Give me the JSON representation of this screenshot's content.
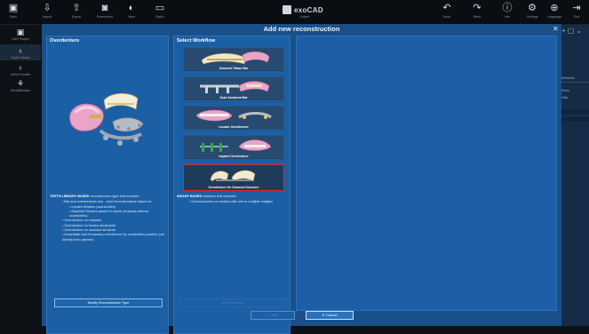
{
  "topbar": {
    "items": [
      {
        "label": "Save",
        "icon": "save-icon",
        "glyph": "▣"
      },
      {
        "label": "Import",
        "icon": "import-icon",
        "glyph": "⇩"
      },
      {
        "label": "Export",
        "icon": "export-icon",
        "glyph": "⇧"
      },
      {
        "label": "Screenshot",
        "icon": "camera-icon",
        "glyph": "◙"
      },
      {
        "label": "View",
        "icon": "contrast-icon",
        "glyph": "◐"
      },
      {
        "label": "Batch",
        "icon": "monitor-icon",
        "glyph": "▭"
      }
    ],
    "brand_name": "exoCAD",
    "brand_sub": "Expert",
    "right_items": [
      {
        "label": "Undo",
        "icon": "undo-icon",
        "glyph": "↶"
      },
      {
        "label": "Redo",
        "icon": "redo-icon",
        "glyph": "↷"
      },
      {
        "label": "Info",
        "icon": "info-icon",
        "glyph": "ⓘ"
      },
      {
        "label": "Settings",
        "icon": "gear-icon",
        "glyph": "⚙"
      },
      {
        "label": "Language",
        "icon": "globe-icon",
        "glyph": "⊕"
      },
      {
        "label": "Exit",
        "icon": "exit-icon",
        "glyph": "⇥"
      }
    ]
  },
  "leftbar": {
    "items": [
      {
        "label": "CAD Project",
        "icon": "cad-project-icon",
        "glyph": "▣"
      },
      {
        "label": "Tooth Library",
        "icon": "tooth-icon",
        "glyph": "♁"
      },
      {
        "label": "Active Models",
        "icon": "models-icon",
        "glyph": "♁"
      },
      {
        "label": "DentalBrowse",
        "icon": "tools-icon",
        "glyph": "⚘"
      }
    ]
  },
  "dialog": {
    "title": "Add new reconstruction",
    "close_glyph": "✕",
    "left_panel": {
      "title": "Overdenture",
      "desc_head": "TEETH LIBRARY BASED",
      "desc_tail": "reconstruction type that includes:",
      "bullets": [
        "Bar and overdentures one - shot reconstructions based on:",
        "Implant libraries (scanbodies)",
        "Scanned Tibases placed in mouth (implants without scanbodies)",
        "Overdenture on implants",
        "Overdenture on locator abutments",
        "Overdenture on scanned structure",
        "Immediate load temporary overdenture by scanbodies position (not directly from planner)"
      ],
      "button": "Modify Reconstruction Type"
    },
    "middle_panel": {
      "title": "Select Workflow",
      "tiles": [
        {
          "label": "Scanned Tibase Bar"
        },
        {
          "label": "Scan Abutment Bar"
        },
        {
          "label": "Locator Overdenture"
        },
        {
          "label": "Implant Overdenture"
        },
        {
          "label": "Overdenture On Scanned Structure"
        }
      ],
      "selected_index": 4,
      "desc_head": "WAXUP BASED",
      "desc_tail": "workflow that includes:",
      "bullet": "Overstructures on models with one or multiple margins",
      "button": "Next Workflow"
    },
    "footer": {
      "ok": "✓ OK",
      "cancel": "✕ Cancel"
    }
  },
  "rightbar": {
    "rows": [
      "Elements",
      "Show",
      "Hide"
    ]
  }
}
